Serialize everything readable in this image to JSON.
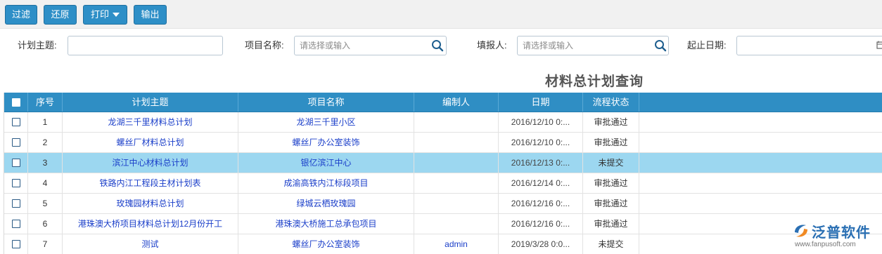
{
  "toolbar": {
    "filter_label": "过滤",
    "reset_label": "还原",
    "print_label": "打印",
    "export_label": "输出"
  },
  "filters": {
    "plan_topic": {
      "label": "计划主题:",
      "value": "",
      "placeholder": ""
    },
    "project_name": {
      "label": "项目名称:",
      "value": "",
      "placeholder": "请选择或输入"
    },
    "reporter": {
      "label": "填报人:",
      "value": "",
      "placeholder": "请选择或输入"
    },
    "date_range": {
      "label": "起止日期:",
      "value": ""
    }
  },
  "page_title": "材料总计划查询",
  "table": {
    "columns": [
      "序号",
      "计划主题",
      "项目名称",
      "编制人",
      "日期",
      "流程状态"
    ],
    "rows": [
      {
        "index": "1",
        "topic": "龙湖三千里材料总计划",
        "project": "龙湖三千里小区",
        "editor": "",
        "date": "2016/12/10 0:...",
        "status": "审批通过",
        "selected": false
      },
      {
        "index": "2",
        "topic": "螺丝厂材料总计划",
        "project": "螺丝厂办公室装饰",
        "editor": "",
        "date": "2016/12/10 0:...",
        "status": "审批通过",
        "selected": false
      },
      {
        "index": "3",
        "topic": "滨江中心材料总计划",
        "project": "银亿滨江中心",
        "editor": "",
        "date": "2016/12/13 0:...",
        "status": "未提交",
        "selected": true
      },
      {
        "index": "4",
        "topic": "铁路内江工程段主材计划表",
        "project": "成渝高铁内江标段项目",
        "editor": "",
        "date": "2016/12/14 0:...",
        "status": "审批通过",
        "selected": false
      },
      {
        "index": "5",
        "topic": "玫瑰园材料总计划",
        "project": "绿城云栖玫瑰园",
        "editor": "",
        "date": "2016/12/16 0:...",
        "status": "审批通过",
        "selected": false
      },
      {
        "index": "6",
        "topic": "港珠澳大桥项目材料总计划12月份开工",
        "project": "港珠澳大桥施工总承包项目",
        "editor": "",
        "date": "2016/12/16 0:...",
        "status": "审批通过",
        "selected": false
      },
      {
        "index": "7",
        "topic": "测试",
        "project": "螺丝厂办公室装饰",
        "editor": "admin",
        "date": "2019/3/28 0:0...",
        "status": "未提交",
        "selected": false
      }
    ]
  },
  "watermark": {
    "brand": "泛普软件",
    "url": "www.fanpusoft.com"
  },
  "colors": {
    "accent": "#2e8fc7",
    "header_bg": "#2f8ec4",
    "selected_row": "#9cd7f0",
    "link": "#1a3ec9"
  },
  "icons": [
    "search-icon",
    "calendar-icon",
    "checkbox-icon",
    "caret-down-icon",
    "logo-icon"
  ]
}
